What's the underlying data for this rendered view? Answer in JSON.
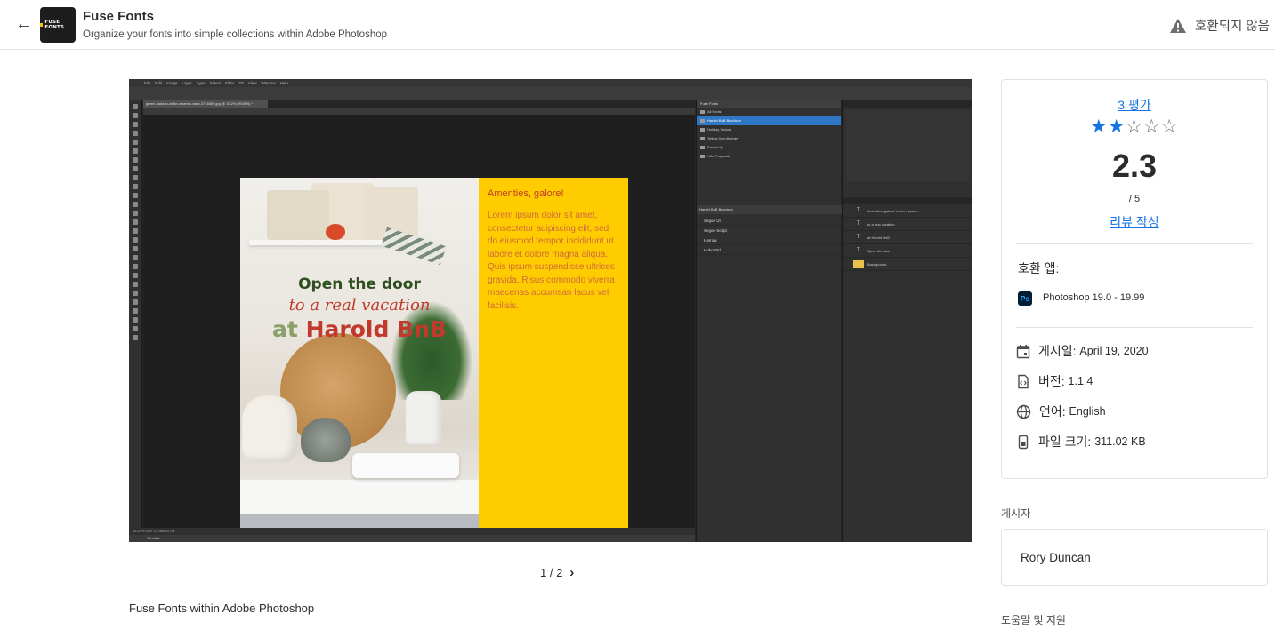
{
  "header": {
    "back_icon": "arrow-left-icon",
    "logo_text": "FUSE FONTS",
    "title": "Fuse Fonts",
    "subtitle": "Organize your fonts into simple collections within Adobe Photoshop",
    "compat_status": "호환되지 않음",
    "warning_icon": "warning-triangle-icon"
  },
  "screenshot": {
    "ps_menu": [
      "File",
      "Edit",
      "Image",
      "Layer",
      "Type",
      "Select",
      "Filter",
      "3D",
      "View",
      "Window",
      "Help"
    ],
    "doc_tab": "green-plant-in-white-ceramic-vase-3716659.jpg @ 15.2% (RGB/8) *",
    "status_text": "15.23%     Doc: 23.4M/53.7M",
    "timeline_label": "Timeline",
    "doc": {
      "line1": "Open the door",
      "line2": "to a real vacation",
      "line3_at": "at",
      "line3_rest": "Harold BnB",
      "side_heading": "Amenties, galore!",
      "side_body": "Lorem ipsum dolor sit amet, consectetur adipiscing elit, sed do eiusmod tempor incididunt ut labore et dolore magna aliqua. Quis ipsum suspendisse ultrices gravida. Risus commodo viverra maecenas accumsan lacus vel facilisis."
    },
    "fuse_panel": {
      "title": "Fuse Fonts",
      "collections": [
        "All Fonts",
        "Harold BnB Brochure",
        "Holiday Visions",
        "Yellow Dog Itinerary",
        "Saved Up",
        "Hike Proposal"
      ],
      "selected_index": 1,
      "sub_header": "Harold BnB Brochure",
      "fonts": [
        "Segoe UI",
        "Segoe Script",
        "Harrow",
        "Hobo Std"
      ]
    },
    "layers": [
      "Amenties, galore! Lorem ipsum...",
      "to a real vacation",
      "at Harold BnB",
      "Open the door",
      "Background"
    ]
  },
  "pager": {
    "text": "1 / 2",
    "next_icon": "chevron-right-icon"
  },
  "description": "Fuse Fonts within Adobe Photoshop",
  "rating": {
    "count_link": "3 평가",
    "value": 2.3,
    "filled_stars": 2,
    "total_stars": 5,
    "score_text": "2.3",
    "max_text": "/ 5",
    "review_link": "리뷰 작성",
    "accent": "#1473e6"
  },
  "details": {
    "compat_label": "호환 앱:",
    "ps_badge": "Ps",
    "ps_version": "Photoshop 19.0 - 19.99",
    "published_label": "게시일:",
    "published_value": "April 19, 2020",
    "version_label": "버전:",
    "version_value": "1.1.4",
    "language_label": "언어:",
    "language_value": "English",
    "filesize_label": "파일 크기:",
    "filesize_value": "311.02 KB"
  },
  "publisher": {
    "label": "게시자",
    "name": "Rory Duncan"
  },
  "help": {
    "label": "도움말 및 지원"
  }
}
